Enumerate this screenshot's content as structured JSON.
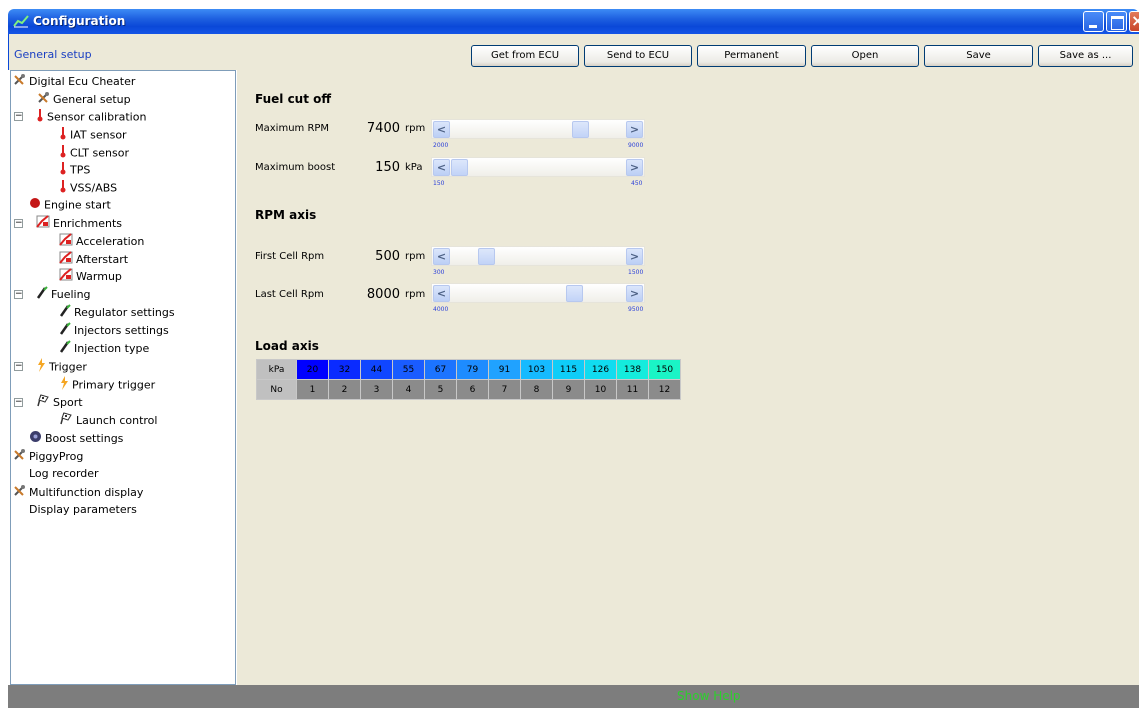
{
  "window": {
    "title": "Configuration"
  },
  "toolbar": {
    "section_title": "General setup",
    "buttons": [
      "Get from ECU",
      "Send to ECU",
      "Permanent",
      "Open",
      "Save",
      "Save as ..."
    ]
  },
  "tree": [
    {
      "label": "Digital Ecu Cheater",
      "icon": "tools-icon"
    },
    {
      "label": "General setup",
      "icon": "tools-icon"
    },
    {
      "label": "Sensor calibration",
      "icon": "thermometer-icon",
      "expander": "minus"
    },
    {
      "label": "IAT sensor",
      "icon": "thermometer-icon"
    },
    {
      "label": "CLT sensor",
      "icon": "thermometer-icon"
    },
    {
      "label": "TPS",
      "icon": "thermometer-icon"
    },
    {
      "label": "VSS/ABS",
      "icon": "thermometer-icon"
    },
    {
      "label": "Engine start",
      "icon": "red-dot-icon"
    },
    {
      "label": "Enrichments",
      "icon": "chart-icon",
      "expander": "minus"
    },
    {
      "label": "Acceleration",
      "icon": "chart-icon"
    },
    {
      "label": "Afterstart",
      "icon": "chart-icon"
    },
    {
      "label": "Warmup",
      "icon": "chart-icon"
    },
    {
      "label": "Fueling",
      "icon": "injector-icon",
      "expander": "minus"
    },
    {
      "label": "Regulator settings",
      "icon": "injector-icon"
    },
    {
      "label": "Injectors settings",
      "icon": "injector-icon"
    },
    {
      "label": "Injection type",
      "icon": "injector-icon"
    },
    {
      "label": "Trigger",
      "icon": "spark-icon",
      "expander": "minus"
    },
    {
      "label": "Primary trigger",
      "icon": "spark-icon"
    },
    {
      "label": "Sport",
      "icon": "flag-icon",
      "expander": "minus"
    },
    {
      "label": "Launch control",
      "icon": "flag-icon"
    },
    {
      "label": "Boost settings",
      "icon": "turbo-icon"
    },
    {
      "label": "PiggyProg",
      "icon": "tools-icon"
    },
    {
      "label": "Log recorder",
      "icon": ""
    },
    {
      "label": "Multifunction display",
      "icon": "tools-icon"
    },
    {
      "label": "Display parameters",
      "icon": ""
    }
  ],
  "fuel_cut": {
    "title": "Fuel cut off",
    "max_rpm": {
      "label": "Maximum RPM",
      "value": "7400",
      "unit": "rpm",
      "min": "2000",
      "max": "9000",
      "level": 0.77
    },
    "max_boost": {
      "label": "Maximum boost",
      "value": "150",
      "unit": "kPa",
      "min": "150",
      "max": "450",
      "level": 0.0
    }
  },
  "rpm_axis": {
    "title": "RPM axis",
    "first_cell": {
      "label": "First Cell Rpm",
      "value": "500",
      "unit": "rpm",
      "min": "300",
      "max": "1500",
      "level": 0.17
    },
    "last_cell": {
      "label": "Last Cell Rpm",
      "value": "8000",
      "unit": "rpm",
      "min": "4000",
      "max": "9500",
      "level": 0.73
    }
  },
  "load_axis": {
    "title": "Load axis",
    "row_labels": [
      "kPa",
      "No"
    ],
    "kpa": [
      "20",
      "32",
      "44",
      "55",
      "67",
      "79",
      "91",
      "103",
      "115",
      "126",
      "138",
      "150"
    ],
    "idx": [
      "1",
      "2",
      "3",
      "4",
      "5",
      "6",
      "7",
      "8",
      "9",
      "10",
      "11",
      "12"
    ],
    "colors": [
      "#0000ff",
      "#0a2bff",
      "#1046ff",
      "#1a5cff",
      "#1c74ff",
      "#1e8cff",
      "#20a2ff",
      "#16baff",
      "#0fcdf8",
      "#11dcf0",
      "#14ecdd",
      "#1af5c6"
    ]
  },
  "status": {
    "help": "Show Help"
  }
}
